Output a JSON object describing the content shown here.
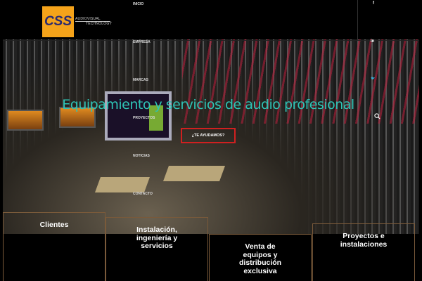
{
  "logo": {
    "mark": "CSS",
    "line1": "AUDIOVISUAL",
    "line2": "TECHNOLOGY"
  },
  "nav": [
    "INICIO",
    "EMPRESA",
    "MARCAS",
    "PROYECTOS",
    "NOTICIAS",
    "CONTACTO"
  ],
  "social": {
    "facebook": "f",
    "linkedin": "in",
    "twitter": "🐦"
  },
  "hero": {
    "title": "Equipamiento y servicios de audio profesional",
    "cta": "¿TE AYUDAMOS?"
  },
  "cards": [
    "Clientes",
    "Instalación, ingeniería y servicios",
    "Venta de equipos y distribución exclusiva",
    "Proyectos e instalaciones"
  ],
  "colors": {
    "accent": "#2ec4b6",
    "cta_border": "#d02020",
    "logo_bg": "#f5a31a"
  }
}
